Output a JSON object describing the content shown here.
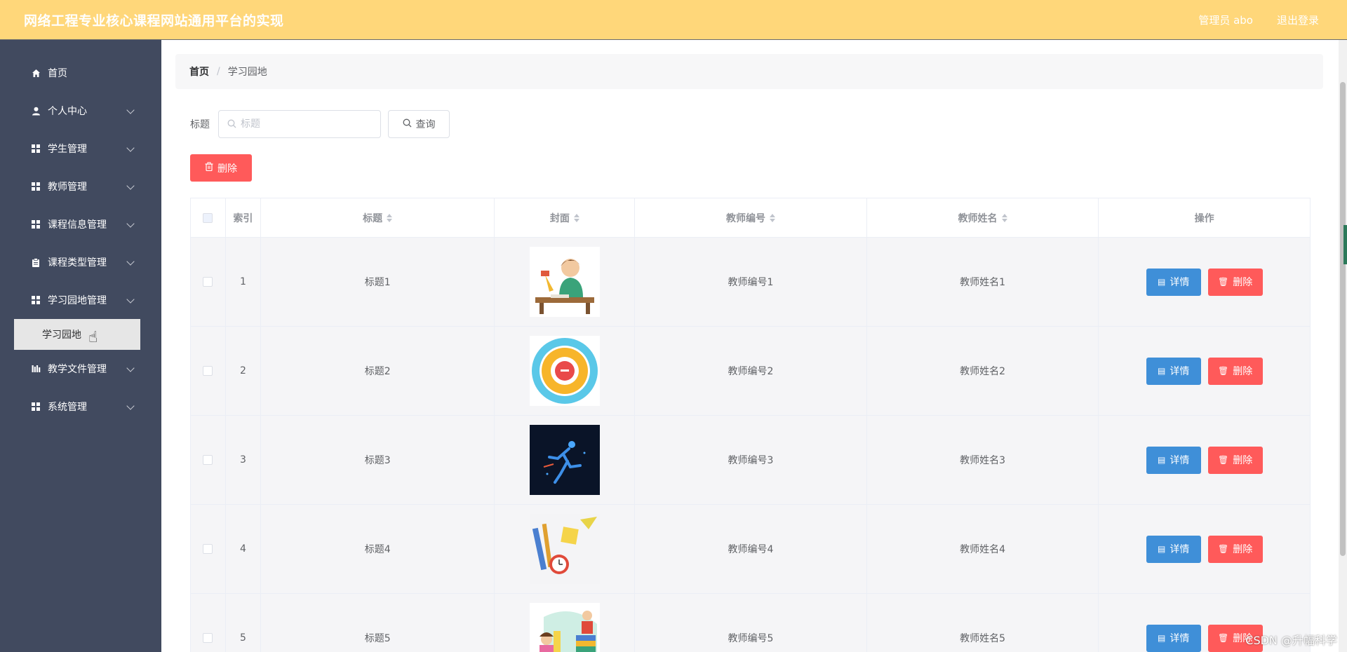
{
  "header": {
    "title": "网络工程专业核心课程网站通用平台的实现",
    "user": "管理员 abo",
    "logout": "退出登录"
  },
  "sidebar": {
    "items": [
      {
        "label": "首页",
        "icon": "home-icon"
      },
      {
        "label": "个人中心",
        "icon": "user-icon"
      },
      {
        "label": "学生管理",
        "icon": "grid-icon"
      },
      {
        "label": "教师管理",
        "icon": "grid-icon"
      },
      {
        "label": "课程信息管理",
        "icon": "grid-icon"
      },
      {
        "label": "课程类型管理",
        "icon": "clipboard-icon"
      },
      {
        "label": "学习园地管理",
        "icon": "grid-icon"
      },
      {
        "label": "教学文件管理",
        "icon": "bar-chart-icon"
      },
      {
        "label": "系统管理",
        "icon": "grid-icon"
      }
    ],
    "active_sub": "学习园地"
  },
  "breadcrumb": {
    "home": "首页",
    "separator": "/",
    "current": "学习园地"
  },
  "search": {
    "label": "标题",
    "placeholder": "标题",
    "button": "查询"
  },
  "bulk_delete": "删除",
  "table": {
    "headers": [
      "索引",
      "标题",
      "封面",
      "教师编号",
      "教师姓名",
      "操作"
    ],
    "detail_label": "详情",
    "delete_label": "删除",
    "rows": [
      {
        "index": "1",
        "title": "标题1",
        "teacher_no": "教师编号1",
        "teacher_name": "教师姓名1",
        "cover": "student-at-desk illustration"
      },
      {
        "index": "2",
        "title": "标题2",
        "teacher_no": "教师编号2",
        "teacher_name": "教师姓名2",
        "cover": "circular diagram"
      },
      {
        "index": "3",
        "title": "标题3",
        "teacher_no": "教师编号3",
        "teacher_name": "教师姓名3",
        "cover": "runner on dark background"
      },
      {
        "index": "4",
        "title": "标题4",
        "teacher_no": "教师编号4",
        "teacher_name": "教师姓名4",
        "cover": "stationery and clock"
      },
      {
        "index": "5",
        "title": "标题5",
        "teacher_no": "教师编号5",
        "teacher_name": "教师姓名5",
        "cover": "children reading"
      }
    ]
  },
  "watermark": "CSDN @升幅科学",
  "colors": {
    "header_bg": "#ffd77a",
    "sidebar_bg": "#414a5f",
    "primary": "#3f8fd8",
    "danger": "#ff5a5a"
  }
}
